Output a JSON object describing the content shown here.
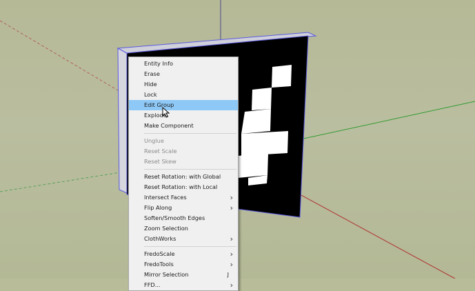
{
  "menu": {
    "items": [
      {
        "label": "Entity Info",
        "enabled": true
      },
      {
        "label": "Erase",
        "enabled": true
      },
      {
        "label": "Hide",
        "enabled": true
      },
      {
        "label": "Lock",
        "enabled": true
      },
      {
        "label": "Edit Group",
        "enabled": true,
        "highlighted": true
      },
      {
        "label": "Explode",
        "enabled": true
      },
      {
        "label": "Make Component",
        "enabled": true
      },
      {
        "separator": true
      },
      {
        "label": "Unglue",
        "enabled": false
      },
      {
        "label": "Reset Scale",
        "enabled": false
      },
      {
        "label": "Reset Skew",
        "enabled": false
      },
      {
        "separator": true
      },
      {
        "label": "Reset Rotation: with Global",
        "enabled": true
      },
      {
        "label": "Reset Rotation: with Local",
        "enabled": true
      },
      {
        "label": "Intersect Faces",
        "enabled": true,
        "submenu": true
      },
      {
        "label": "Flip Along",
        "enabled": true,
        "submenu": true
      },
      {
        "label": "Soften/Smooth Edges",
        "enabled": true
      },
      {
        "label": "Zoom Selection",
        "enabled": true
      },
      {
        "label": "ClothWorks",
        "enabled": true,
        "submenu": true
      },
      {
        "separator": true
      },
      {
        "label": "FredoScale",
        "enabled": true,
        "submenu": true
      },
      {
        "label": "FredoTools",
        "enabled": true,
        "submenu": true
      },
      {
        "label": "Mirror Selection",
        "enabled": true,
        "shortcut": "J"
      },
      {
        "label": "FFD...",
        "enabled": true,
        "submenu": true
      }
    ]
  },
  "colors": {
    "ground": "#b8bc98",
    "menu_background": "#f0f0f0",
    "menu_highlight": "#8ec8f6",
    "selection_outline": "#5a5ae0",
    "axis_red": "#b03030",
    "axis_green": "#2f9a2f",
    "axis_blue": "#4a4a8a"
  },
  "icons": {
    "cursor": "arrow-pointer-icon",
    "submenu_arrow": "chevron-right-icon"
  }
}
